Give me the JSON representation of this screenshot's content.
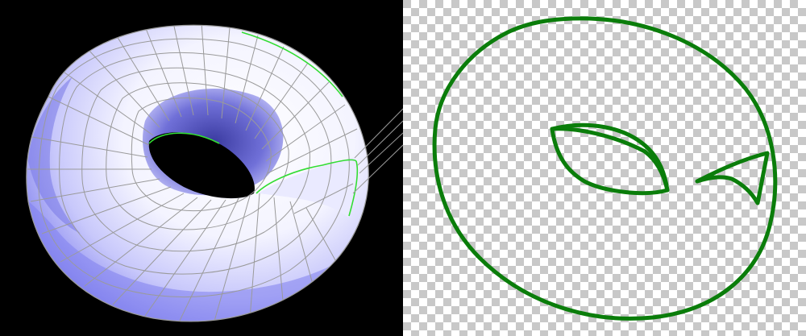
{
  "left_view": {
    "background": "#000000",
    "wireframe_color": "#9a9a9a",
    "highlight_color": "#33dd33",
    "shade_dark": "#6f6fe8",
    "shade_light": "#ffffff",
    "subject": "shaded-torus-with-wireframe"
  },
  "right_view": {
    "background": "transparent-checkerboard",
    "checker_light": "#ffffff",
    "checker_dark": "#c8c8c8",
    "outline_color": "#0a7d0a",
    "subject": "silhouette-outline"
  }
}
